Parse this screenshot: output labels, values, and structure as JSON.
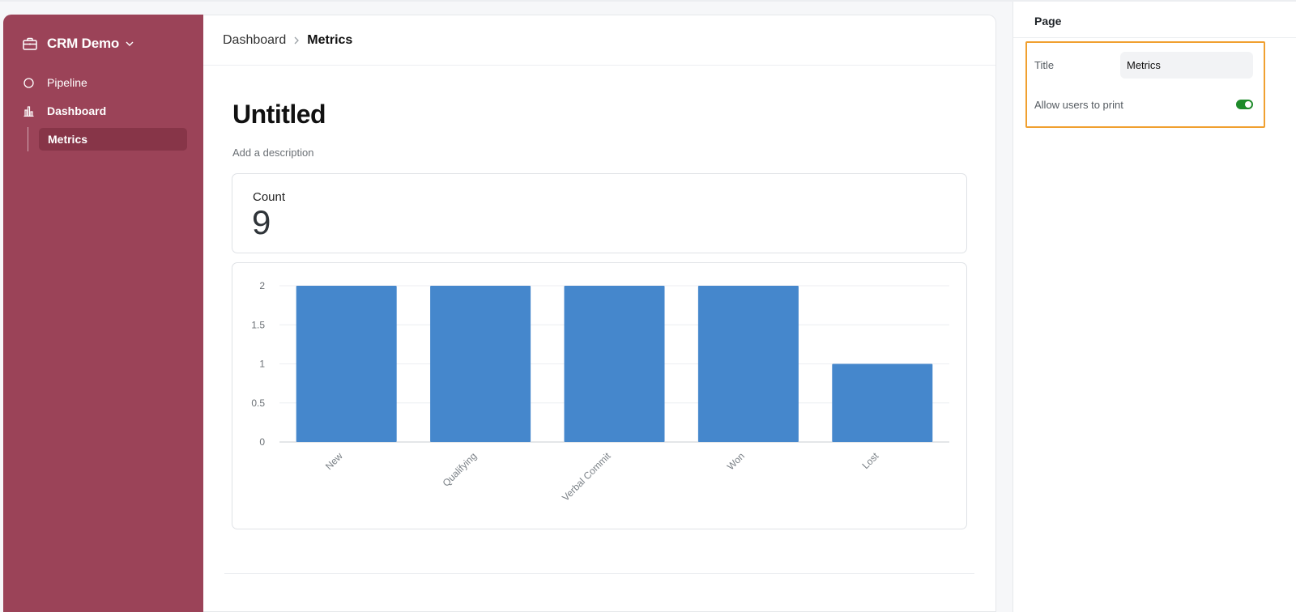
{
  "app": {
    "workspace_name": "CRM Demo"
  },
  "sidebar": {
    "items": [
      {
        "label": "Pipeline",
        "icon": "circle-icon"
      },
      {
        "label": "Dashboard",
        "icon": "bar-chart-icon"
      }
    ],
    "sub_items": [
      {
        "label": "Metrics"
      }
    ]
  },
  "breadcrumb": {
    "items": [
      "Dashboard",
      "Metrics"
    ]
  },
  "page": {
    "title": "Untitled",
    "description_placeholder": "Add a description"
  },
  "count_card": {
    "label": "Count",
    "value": "9"
  },
  "chart_data": {
    "type": "bar",
    "categories": [
      "New",
      "Qualifying",
      "Verbal Commit",
      "Won",
      "Lost"
    ],
    "values": [
      2,
      2,
      2,
      2,
      1
    ],
    "ylim": [
      0,
      2
    ],
    "yticks": [
      "0",
      "0.5",
      "1",
      "1.5",
      "2"
    ],
    "grid": true,
    "bar_color": "#4587cc"
  },
  "settings_panel": {
    "title": "Page",
    "title_field_label": "Title",
    "title_field_value": "Metrics",
    "print_toggle_label": "Allow users to print",
    "print_toggle_on": true
  },
  "colors": {
    "sidebar_bg": "#9b4358",
    "sidebar_active": "#873548",
    "highlight_border": "#f0a030",
    "toggle_on": "#1e8a2a"
  }
}
